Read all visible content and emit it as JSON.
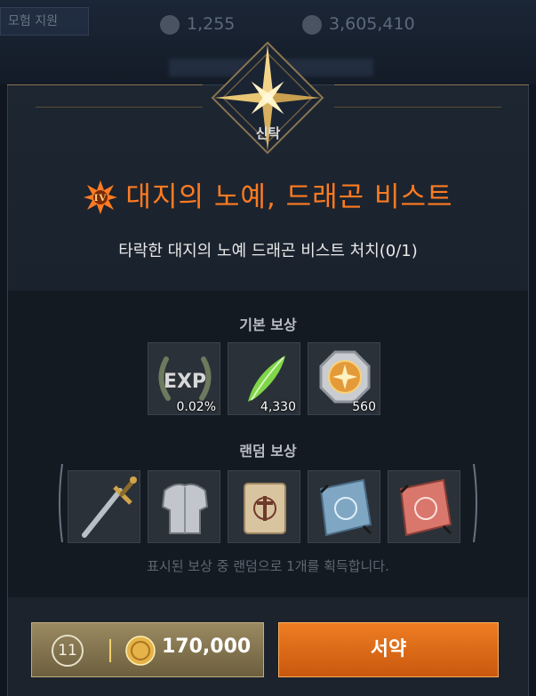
{
  "top_bar": {
    "tab_label": "모험 지원",
    "resource_1": "1,255",
    "resource_2": "3,605,410"
  },
  "emblem": {
    "label": "신탁",
    "icon": "compass-star-icon"
  },
  "quest": {
    "title": "대지의 노예, 드래곤 비스트",
    "description": "타락한 대지의 노예 드래곤 비스트 처치(0/1)",
    "badge_icon": "sunburst-badge-icon"
  },
  "basic_rewards": {
    "title": "기본 보상",
    "items": [
      {
        "name": "exp",
        "icon": "exp-laurel-icon",
        "amount": "0.02%"
      },
      {
        "name": "feather",
        "icon": "green-feather-icon",
        "amount": "4,330"
      },
      {
        "name": "coin-badge",
        "icon": "octagon-coin-icon",
        "amount": "560"
      }
    ]
  },
  "random_rewards": {
    "title": "랜덤 보상",
    "items": [
      {
        "name": "sword",
        "icon": "sword-icon"
      },
      {
        "name": "armor",
        "icon": "plate-armor-icon"
      },
      {
        "name": "scroll-parchment",
        "icon": "parchment-scroll-icon"
      },
      {
        "name": "scroll-blue",
        "icon": "blue-scroll-icon"
      },
      {
        "name": "scroll-red",
        "icon": "red-scroll-icon"
      }
    ],
    "note": "표시된 보상 중 랜덤으로 1개를 획득합니다."
  },
  "actions": {
    "cost_count": "11",
    "cost_price": "170,000",
    "accept_label": "서약"
  },
  "colors": {
    "title_orange": "#ff7b22",
    "accept_button": "#e06a18",
    "panel_bg": "#1a222d"
  }
}
